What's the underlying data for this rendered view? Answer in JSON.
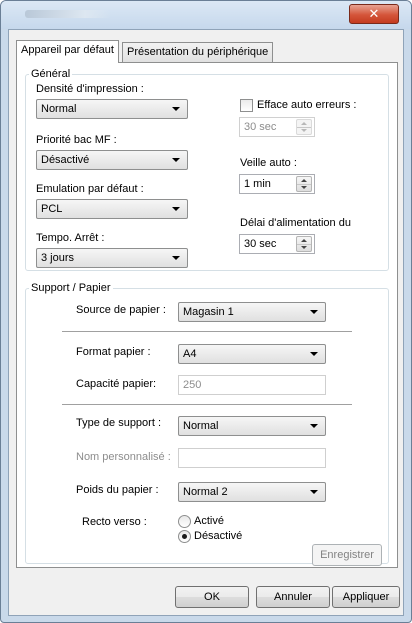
{
  "tabs": [
    {
      "label": "Appareil par défaut",
      "active": true
    },
    {
      "label": "Présentation du périphérique",
      "active": false
    }
  ],
  "general": {
    "title": "Général",
    "print_density": {
      "label": "Densité d'impression :",
      "value": "Normal"
    },
    "mp_tray_priority": {
      "label": "Priorité bac MF :",
      "value": "Désactivé"
    },
    "default_emulation": {
      "label": "Emulation par défaut :",
      "value": "PCL"
    },
    "timer_off": {
      "label": "Tempo. Arrêt :",
      "value": "3 jours"
    },
    "auto_error_clear": {
      "label": "Efface auto erreurs :",
      "checked": false,
      "value": "30 sec"
    },
    "auto_sleep": {
      "label": "Veille auto :",
      "value": "1 min"
    },
    "feed_delay": {
      "label": "Délai d'alimentation du",
      "value": "30 sec"
    }
  },
  "media": {
    "title": "Support / Papier",
    "paper_source": {
      "label": "Source de papier :",
      "value": "Magasin 1"
    },
    "paper_size": {
      "label": "Format papier :",
      "value": "A4"
    },
    "paper_capacity": {
      "label": "Capacité papier:",
      "value": "250"
    },
    "media_type": {
      "label": "Type de support :",
      "value": "Normal"
    },
    "custom_name": {
      "label": "Nom personnalisé :",
      "value": ""
    },
    "paper_weight": {
      "label": "Poids du papier :",
      "value": "Normal 2"
    },
    "duplex": {
      "label": "Recto verso :",
      "options": [
        "Activé",
        "Désactivé"
      ],
      "selected": "Désactivé"
    },
    "save_label": "Enregistrer"
  },
  "footer": {
    "ok_label": "OK",
    "cancel_label": "Annuler",
    "apply_label": "Appliquer"
  },
  "window": {
    "close_glyph": "✕"
  }
}
